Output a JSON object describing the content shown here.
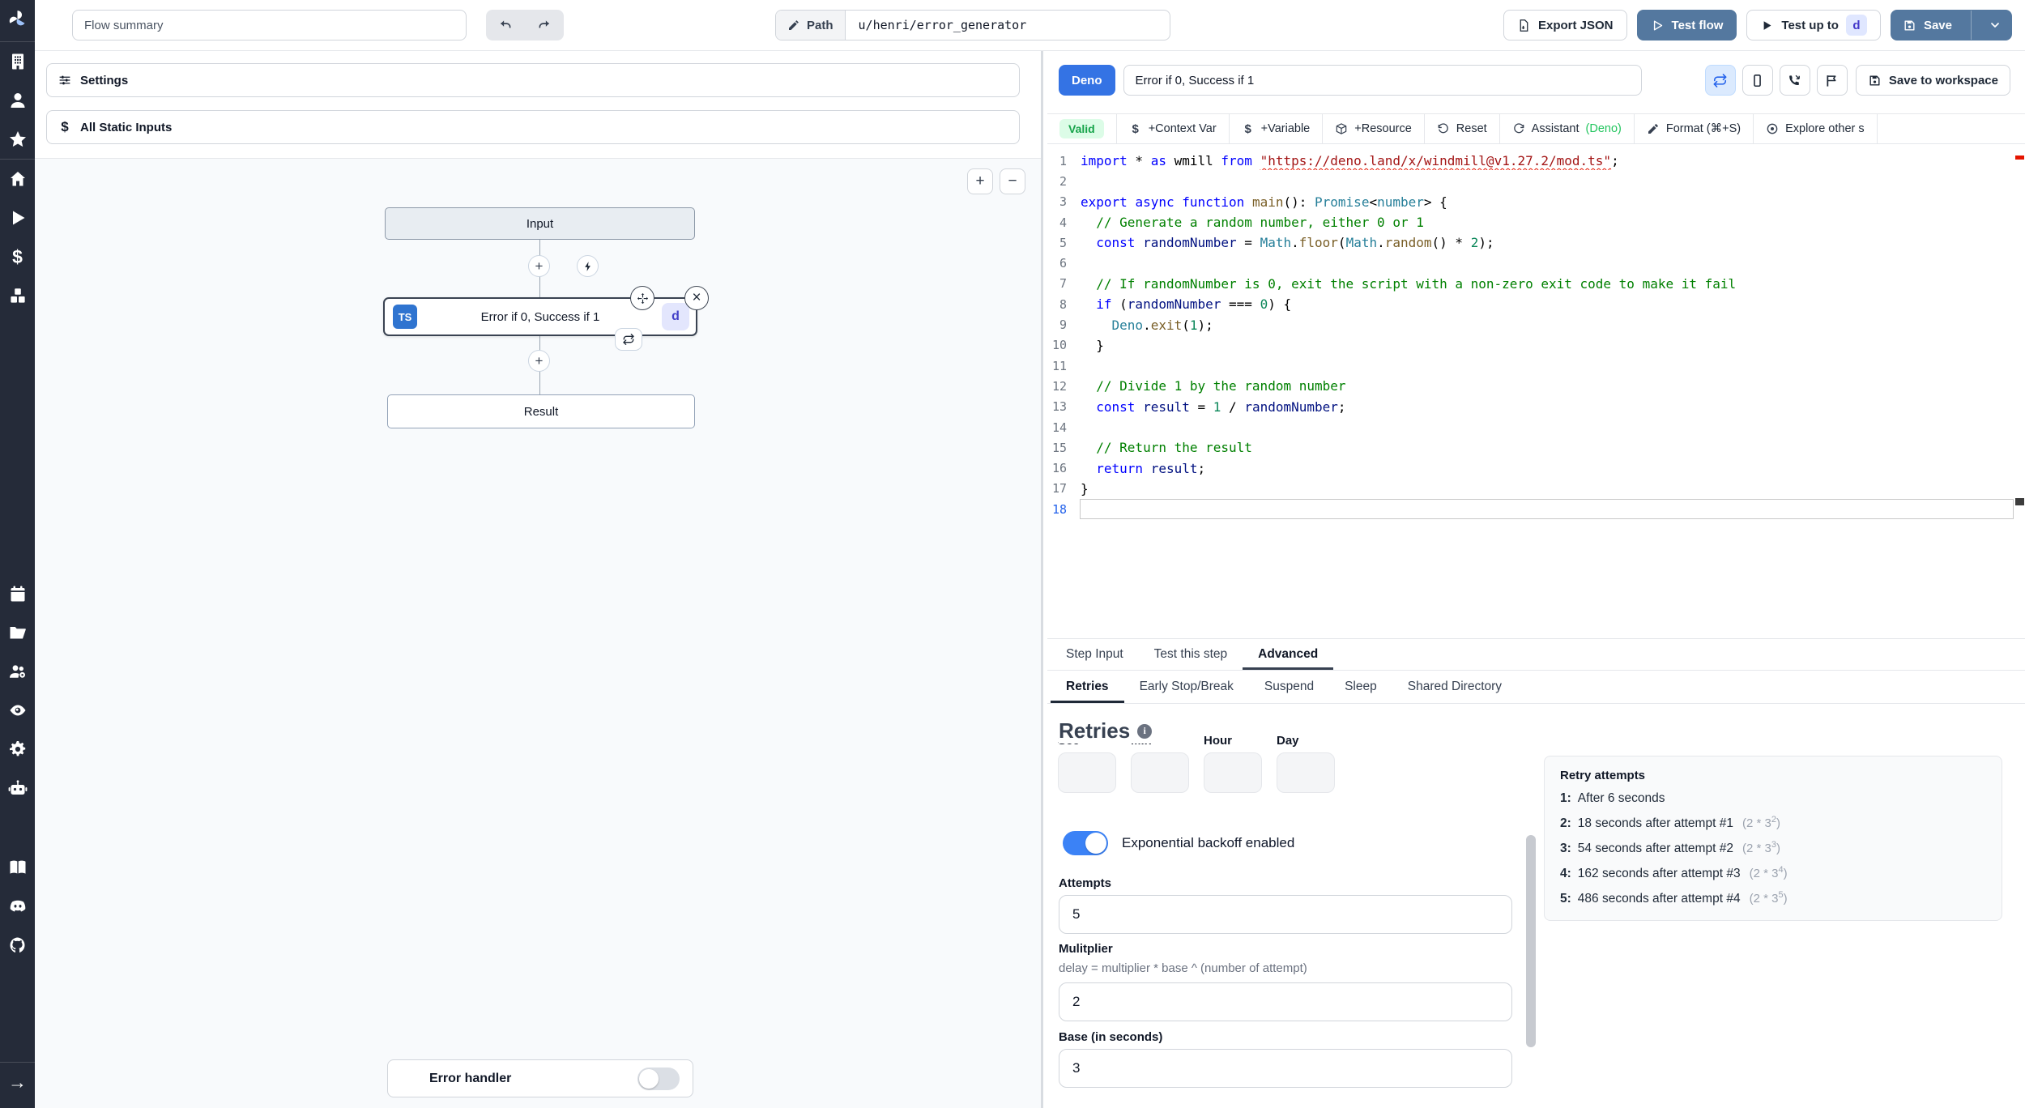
{
  "colors": {
    "sidebar_bg": "#252b39",
    "primary_blue": "#54789f",
    "deno_blue": "#3473e4",
    "ts_blue": "#2f74d0",
    "toggle_on": "#3b82f6",
    "valid_green": "#16a34a"
  },
  "topbar": {
    "flow_summary_value": "Flow summary",
    "path_label": "Path",
    "path_value": "u/henri/error_generator",
    "export_json_label": "Export JSON",
    "test_flow_label": "Test flow",
    "test_up_to_label": "Test up to",
    "test_up_to_badge": "d",
    "save_label": "Save"
  },
  "sidebar": {
    "groups": [
      [
        "building",
        "user",
        "star"
      ],
      [
        "home",
        "play",
        "dollar",
        "cubes"
      ],
      [
        "calendar",
        "folder-open",
        "users-cog",
        "eye",
        "settings",
        "bot"
      ],
      [
        "book",
        "discord",
        "github"
      ],
      [
        "arrow-right"
      ]
    ]
  },
  "left_panel": {
    "settings_label": "Settings",
    "static_inputs_label": "All Static Inputs",
    "zoom_in": "+",
    "zoom_out": "−",
    "graph": {
      "input_node": "Input",
      "step_node_lang": "TS",
      "step_node_label": "Error if 0, Success if 1",
      "step_node_badge": "d",
      "result_node": "Result",
      "error_handler_label": "Error handler"
    }
  },
  "right_panel": {
    "header": {
      "lang_badge": "Deno",
      "step_name_value": "Error if 0, Success if 1",
      "save_to_workspace_label": "Save to workspace"
    },
    "toolbar": {
      "valid_label": "Valid",
      "items": [
        {
          "icon": "dollar-sign",
          "label": "+Context Var"
        },
        {
          "icon": "dollar-sign",
          "label": "+Variable"
        },
        {
          "icon": "box",
          "label": "+Resource"
        },
        {
          "icon": "reset",
          "label": "Reset"
        },
        {
          "icon": "refresh-cw",
          "label": "Assistant ",
          "suffix": "(Deno)"
        },
        {
          "icon": "wand",
          "label": "Format (⌘+S)"
        },
        {
          "icon": "target",
          "label": "Explore other s"
        }
      ]
    },
    "editor": {
      "lines": [
        {
          "n": 1,
          "t": [
            [
              "kw",
              "import"
            ],
            [
              "pl",
              " * "
            ],
            [
              "kw",
              "as"
            ],
            [
              "pl",
              " wmill "
            ],
            [
              "kw",
              "from"
            ],
            [
              "pl",
              " "
            ],
            [
              "str sq",
              "\"https://deno.land/x/windmill@v1.27.2/mod.ts\""
            ],
            [
              "pl",
              ";"
            ]
          ]
        },
        {
          "n": 2,
          "t": []
        },
        {
          "n": 3,
          "t": [
            [
              "kw",
              "export"
            ],
            [
              "pl",
              " "
            ],
            [
              "kw",
              "async"
            ],
            [
              "pl",
              " "
            ],
            [
              "kw",
              "function"
            ],
            [
              "pl",
              " "
            ],
            [
              "fn",
              "main"
            ],
            [
              "pl",
              "(): "
            ],
            [
              "ty",
              "Promise"
            ],
            [
              "pl",
              "<"
            ],
            [
              "ty",
              "number"
            ],
            [
              "pl",
              "> {"
            ]
          ]
        },
        {
          "n": 4,
          "t": [
            [
              "cm",
              "  // Generate a random number, either 0 or 1"
            ]
          ]
        },
        {
          "n": 5,
          "t": [
            [
              "pl",
              "  "
            ],
            [
              "kw",
              "const"
            ],
            [
              "pl",
              " "
            ],
            [
              "vr",
              "randomNumber"
            ],
            [
              "pl",
              " = "
            ],
            [
              "ty",
              "Math"
            ],
            [
              "pl",
              "."
            ],
            [
              "fn",
              "floor"
            ],
            [
              "pl",
              "("
            ],
            [
              "ty",
              "Math"
            ],
            [
              "pl",
              "."
            ],
            [
              "fn",
              "random"
            ],
            [
              "pl",
              "() * "
            ],
            [
              "num",
              "2"
            ],
            [
              "pl",
              ");"
            ]
          ]
        },
        {
          "n": 6,
          "t": []
        },
        {
          "n": 7,
          "t": [
            [
              "cm",
              "  // If randomNumber is 0, exit the script with a non-zero exit code to make it fail"
            ]
          ]
        },
        {
          "n": 8,
          "t": [
            [
              "pl",
              "  "
            ],
            [
              "kw",
              "if"
            ],
            [
              "pl",
              " ("
            ],
            [
              "vr",
              "randomNumber"
            ],
            [
              "pl",
              " === "
            ],
            [
              "num",
              "0"
            ],
            [
              "pl",
              ") {"
            ]
          ]
        },
        {
          "n": 9,
          "t": [
            [
              "pl",
              "    "
            ],
            [
              "ty",
              "Deno"
            ],
            [
              "pl",
              "."
            ],
            [
              "fn",
              "exit"
            ],
            [
              "pl",
              "("
            ],
            [
              "num",
              "1"
            ],
            [
              "pl",
              ");"
            ]
          ]
        },
        {
          "n": 10,
          "t": [
            [
              "pl",
              "  }"
            ]
          ]
        },
        {
          "n": 11,
          "t": []
        },
        {
          "n": 12,
          "t": [
            [
              "cm",
              "  // Divide 1 by the random number"
            ]
          ]
        },
        {
          "n": 13,
          "t": [
            [
              "pl",
              "  "
            ],
            [
              "kw",
              "const"
            ],
            [
              "pl",
              " "
            ],
            [
              "vr",
              "result"
            ],
            [
              "pl",
              " = "
            ],
            [
              "num",
              "1"
            ],
            [
              "pl",
              " / "
            ],
            [
              "vr",
              "randomNumber"
            ],
            [
              "pl",
              ";"
            ]
          ]
        },
        {
          "n": 14,
          "t": []
        },
        {
          "n": 15,
          "t": [
            [
              "cm",
              "  // Return the result"
            ]
          ]
        },
        {
          "n": 16,
          "t": [
            [
              "pl",
              "  "
            ],
            [
              "kw",
              "return"
            ],
            [
              "pl",
              " "
            ],
            [
              "vr",
              "result"
            ],
            [
              "pl",
              ";"
            ]
          ]
        },
        {
          "n": 17,
          "t": [
            [
              "pl",
              "}"
            ]
          ]
        },
        {
          "n": 18,
          "t": [],
          "active": true
        }
      ]
    },
    "tabs": [
      {
        "label": "Step Input",
        "active": false
      },
      {
        "label": "Test this step",
        "active": false
      },
      {
        "label": "Advanced",
        "active": true
      }
    ],
    "subtabs": [
      {
        "label": "Retries",
        "active": true
      },
      {
        "label": "Early Stop/Break",
        "active": false
      },
      {
        "label": "Suspend",
        "active": false
      },
      {
        "label": "Sleep",
        "active": false
      },
      {
        "label": "Shared Directory",
        "active": false
      }
    ],
    "retries": {
      "heading": "Retries",
      "time_labels": [
        "Sec",
        "Min",
        "Hour",
        "Day"
      ],
      "backoff_label": "Exponential backoff enabled",
      "attempts_label": "Attempts",
      "attempts_value": "5",
      "multiplier_label": "Mulitplier",
      "multiplier_help": "delay = multiplier * base ^ (number of attempt)",
      "multiplier_value": "2",
      "base_label": "Base (in seconds)",
      "base_value": "3",
      "retry_panel": {
        "title": "Retry attempts",
        "items": [
          {
            "n": "1:",
            "text": "After 6 seconds"
          },
          {
            "n": "2:",
            "text": "18 seconds after attempt #1",
            "f": "(2 * 3",
            "e": "2"
          },
          {
            "n": "3:",
            "text": "54 seconds after attempt #2",
            "f": "(2 * 3",
            "e": "3"
          },
          {
            "n": "4:",
            "text": "162 seconds after attempt #3",
            "f": "(2 * 3",
            "e": "4"
          },
          {
            "n": "5:",
            "text": "486 seconds after attempt #4",
            "f": "(2 * 3",
            "e": "5"
          }
        ]
      }
    }
  }
}
